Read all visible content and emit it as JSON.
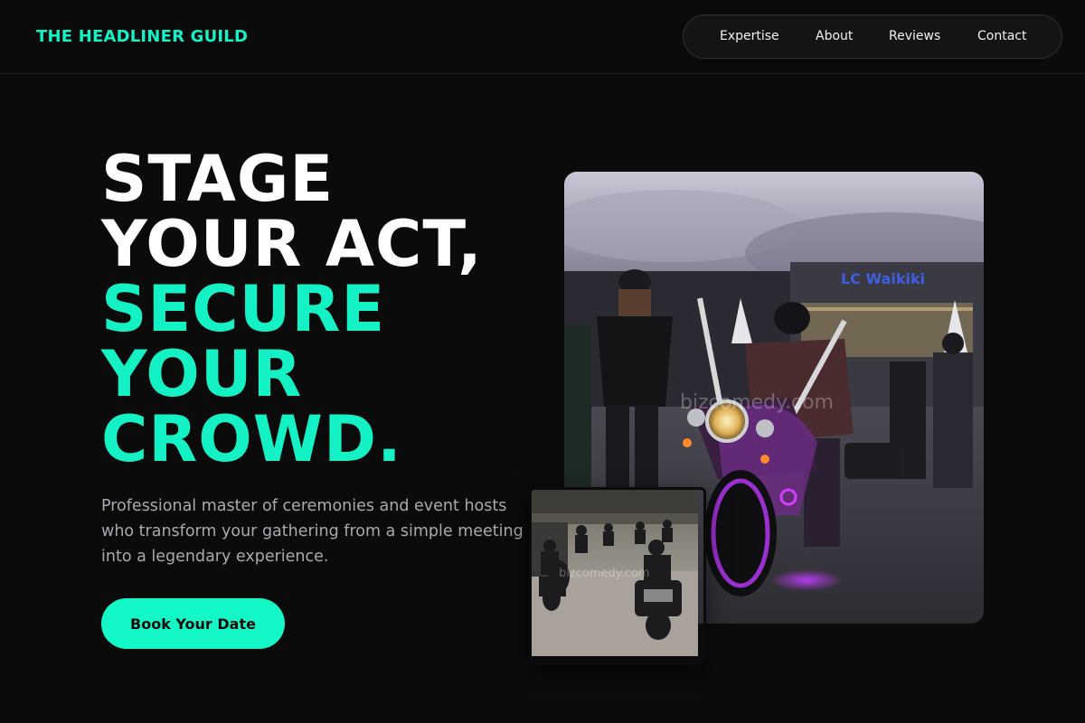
{
  "brand": {
    "name": "THE HEADLINER GUILD",
    "accent_color": "#14f1c4"
  },
  "nav": {
    "items": [
      {
        "label": "Expertise"
      },
      {
        "label": "About"
      },
      {
        "label": "Reviews"
      },
      {
        "label": "Contact"
      }
    ]
  },
  "hero": {
    "headline_white": [
      "STAGE",
      "YOUR ACT,"
    ],
    "headline_accent": [
      "SECURE",
      "YOUR",
      "CROWD."
    ],
    "subtitle": "Professional master of ceremonies and event hosts who transform your gathering from a simple meeting into a legendary experience.",
    "cta_label": "Book Your Date",
    "cta_color": "#14f8c8"
  },
  "images": {
    "main": {
      "subject": "rider-on-purple-lit-motorcycle",
      "storefront_sign": "LC Waikiki",
      "watermark": "bizcomedy.com"
    },
    "thumb": {
      "subject": "group-of-motorcycle-riders",
      "watermark": "bizcomedy.com"
    }
  }
}
